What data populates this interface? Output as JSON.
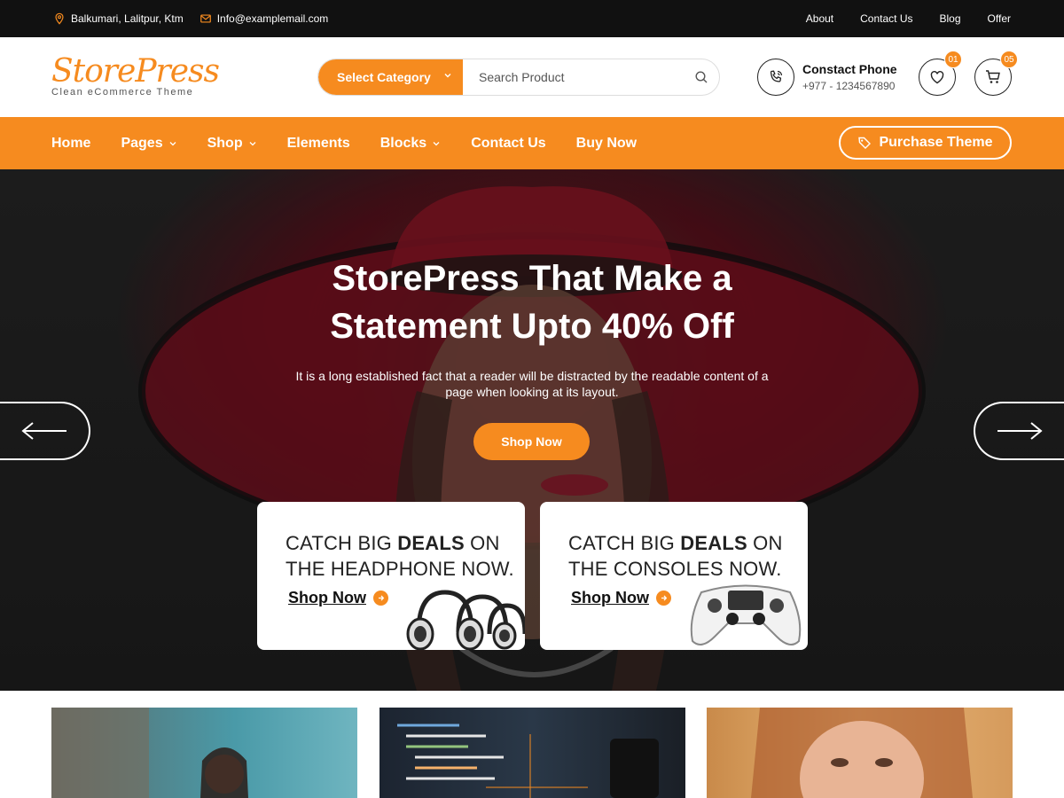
{
  "topbar": {
    "address": "Balkumari, Lalitpur, Ktm",
    "email": "Info@examplemail.com",
    "links": [
      "About",
      "Contact Us",
      "Blog",
      "Offer"
    ]
  },
  "header": {
    "logo_name": "StorePress",
    "logo_tagline": "Clean eCommerce Theme",
    "category_label": "Select Category",
    "search_placeholder": "Search Product",
    "phone_title": "Constact Phone",
    "phone_number": "+977 - 1234567890",
    "wishlist_count": "01",
    "cart_count": "05"
  },
  "nav": {
    "items": [
      "Home",
      "Pages",
      "Shop",
      "Elements",
      "Blocks",
      "Contact Us",
      "Buy Now"
    ],
    "purchase_label": "Purchase Theme"
  },
  "hero": {
    "title": "StorePress That Make a Statement Upto 40% Off",
    "description": "It is a long established fact that a reader will be distracted by the readable content of a page when looking at its layout.",
    "cta_label": "Shop Now"
  },
  "promos": [
    {
      "line1_pre": "CATCH BIG ",
      "line1_bold": "DEALS",
      "line1_post": " ON",
      "line2": "THE HEADPHONE NOW.",
      "link": "Shop Now"
    },
    {
      "line1_pre": "CATCH BIG ",
      "line1_bold": "DEALS",
      "line1_post": " ON",
      "line2": "THE CONSOLES NOW.",
      "link": "Shop Now"
    }
  ],
  "colors": {
    "accent": "#f68b1f",
    "topbar_bg": "#111111"
  }
}
